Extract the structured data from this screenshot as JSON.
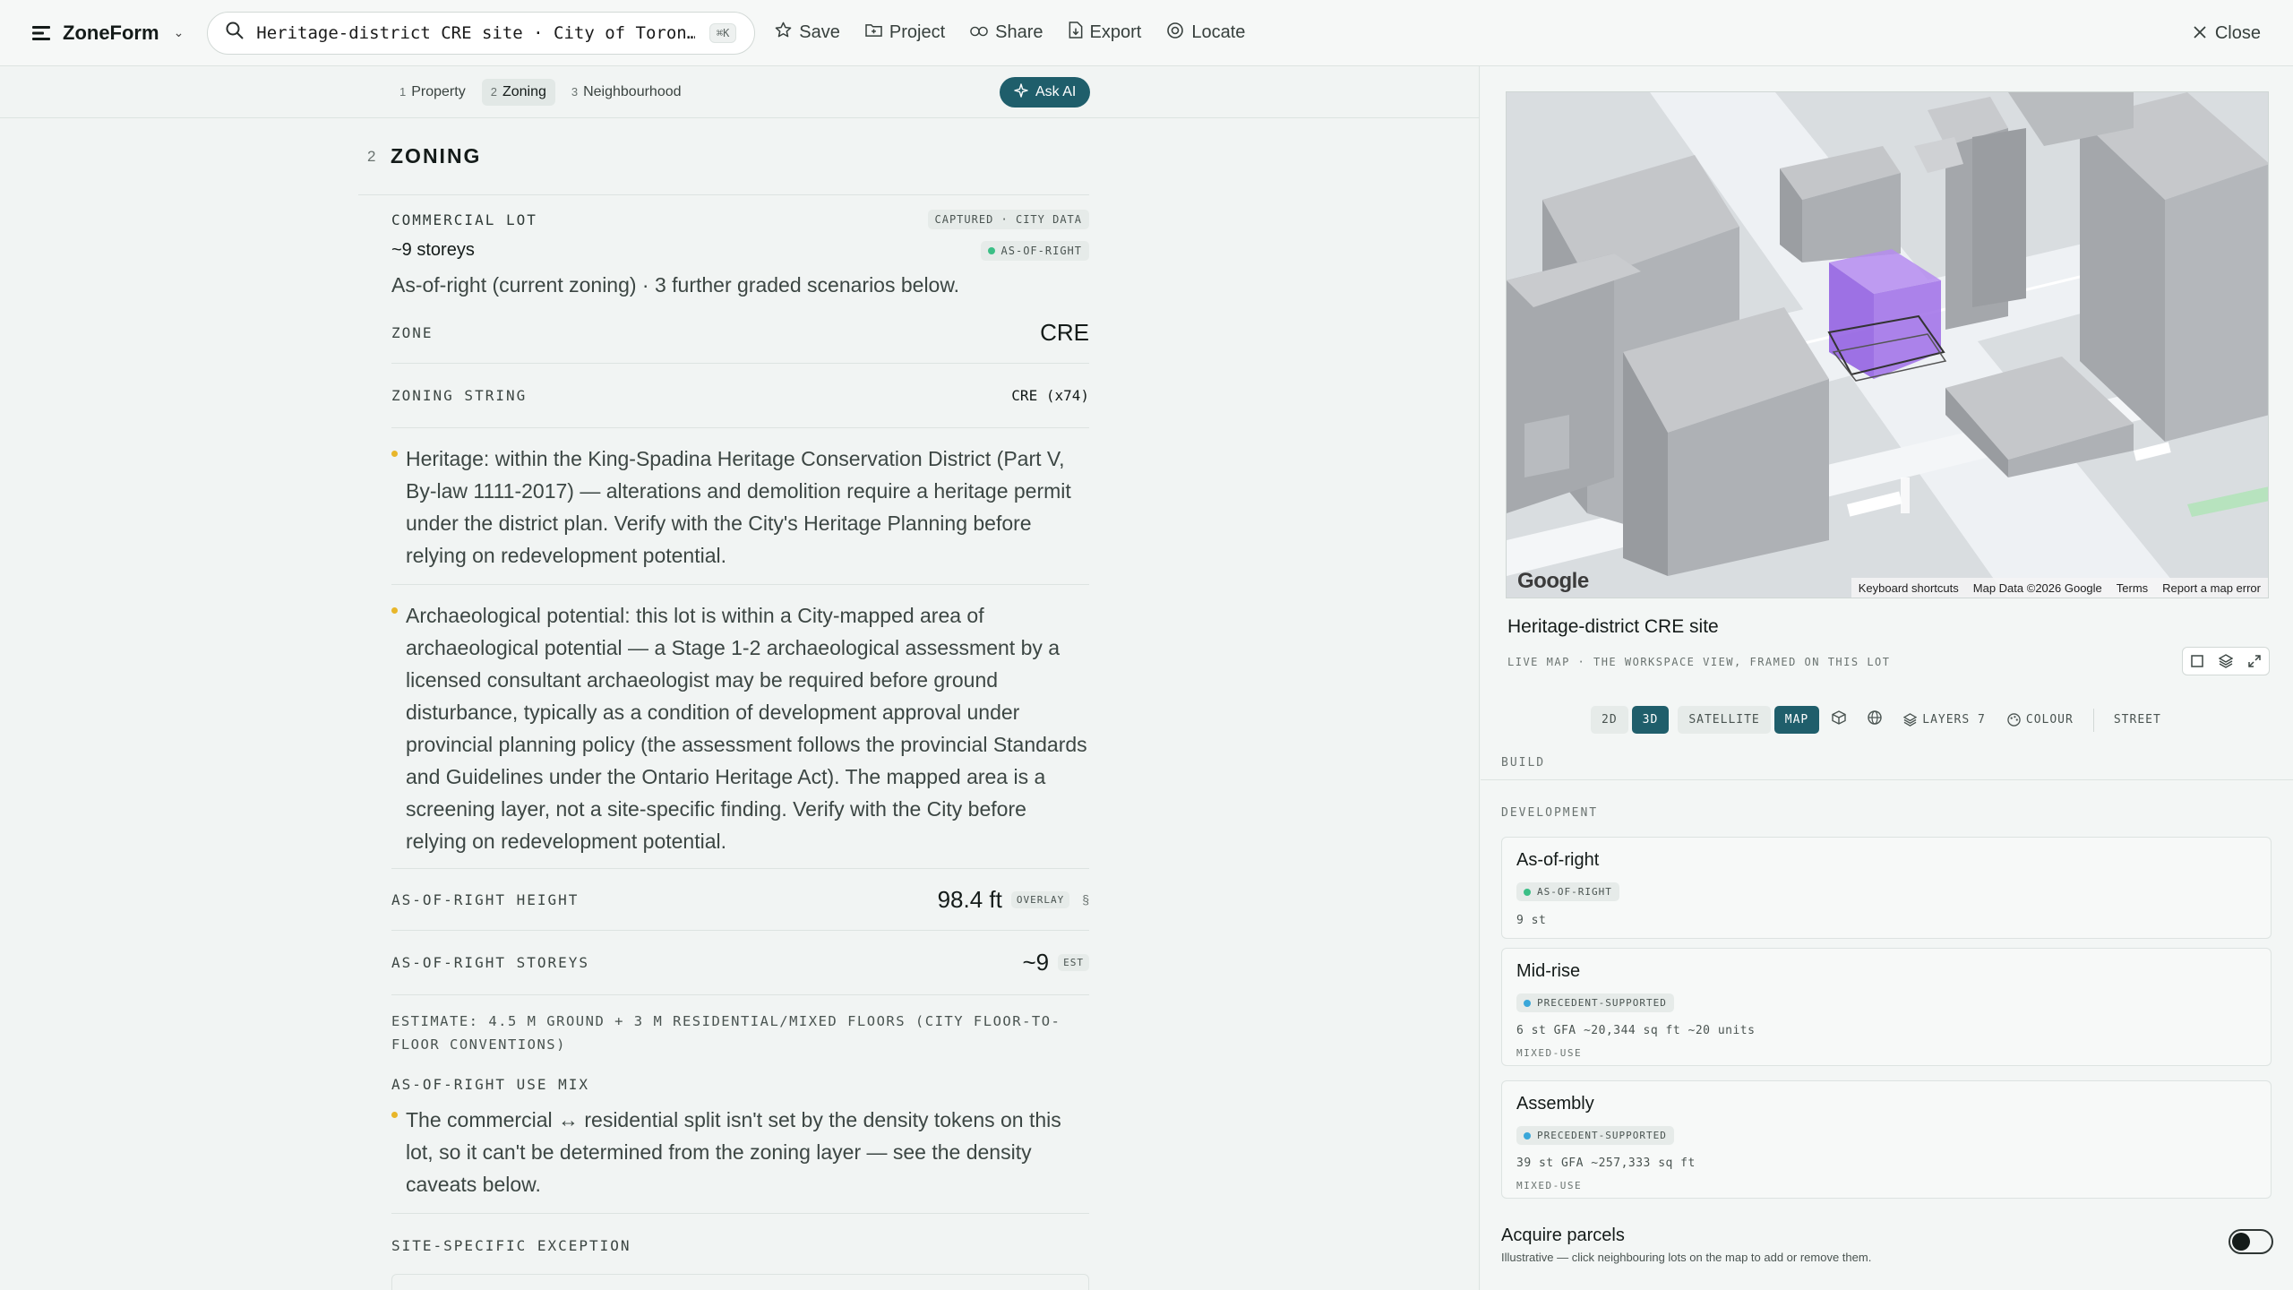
{
  "app": {
    "name": "ZoneForm"
  },
  "search": {
    "query": "Heritage-district CRE site · City of Toron…",
    "shortcut": "⌘K"
  },
  "toolbar": {
    "save": "Save",
    "project": "Project",
    "share": "Share",
    "export": "Export",
    "locate": "Locate",
    "close": "Close"
  },
  "steps": [
    {
      "num": "1",
      "label": "Property"
    },
    {
      "num": "2",
      "label": "Zoning"
    },
    {
      "num": "3",
      "label": "Neighbourhood"
    }
  ],
  "ask_ai": "Ask AI",
  "section": {
    "num": "2",
    "title": "ZONING",
    "lot_label": "COMMERCIAL LOT",
    "lot_tag": "CAPTURED · CITY DATA",
    "storeys": "~9 storeys",
    "storeys_tag": "AS-OF-RIGHT",
    "summary": "As-of-right (current zoning) · 3 further graded scenarios below.",
    "zone_key": "ZONE",
    "zone_val": "CRE",
    "zstring_key": "ZONING STRING",
    "zstring_val": "CRE (x74)",
    "note_heritage": "Heritage: within the King-Spadina Heritage Conservation District (Part V, By-law 1111-2017) — alterations and demolition require a heritage permit under the district plan. Verify with the City's Heritage Planning before relying on redevelopment potential.",
    "note_arch": "Archaeological potential: this lot is within a City-mapped area of archaeological potential — a Stage 1-2 archaeological assessment by a licensed consultant archaeologist may be required before ground disturbance, typically as a condition of development approval under provincial planning policy (the assessment follows the provincial Standards and Guidelines under the Ontario Heritage Act). The mapped area is a screening layer, not a site-specific finding. Verify with the City before relying on redevelopment potential.",
    "height_key": "AS-OF-RIGHT HEIGHT",
    "height_val": "98.4 ft",
    "height_tag": "OVERLAY",
    "height_sect": "§",
    "storeys_key": "AS-OF-RIGHT STOREYS",
    "storeys_val": "~9",
    "storeys_val_tag": "EST",
    "estimate": "ESTIMATE: 4.5 M GROUND + 3 M RESIDENTIAL/MIXED FLOORS (CITY FLOOR-TO-FLOOR CONVENTIONS)",
    "usemix_key": "AS-OF-RIGHT USE MIX",
    "usemix_note": "The commercial ↔ residential split isn't set by the density tokens on this lot, so it can't be determined from the zoning layer — see the density caveats below.",
    "exception_key": "SITE-SPECIFIC EXCEPTION"
  },
  "map": {
    "google": "Google",
    "attribution": [
      "Keyboard shortcuts",
      "Map Data ©2026 Google",
      "Terms",
      "Report a map error"
    ],
    "site_title": "Heritage-district CRE site",
    "site_sub": "LIVE MAP · THE WORKSPACE VIEW, FRAMED ON THIS LOT",
    "views": {
      "v2d": "2D",
      "v3d": "3D",
      "satellite": "SATELLITE",
      "map": "MAP",
      "layers": "LAYERS 7",
      "colour": "COLOUR",
      "street": "STREET"
    }
  },
  "build_label": "BUILD",
  "development_label": "DEVELOPMENT",
  "scenarios": [
    {
      "title": "As-of-right",
      "tag": "AS-OF-RIGHT",
      "meta": "9 st",
      "meta2": ""
    },
    {
      "title": "Mid-rise",
      "tag": "PRECEDENT-SUPPORTED",
      "meta": "6 st  GFA ~20,344 sq ft  ~20 units",
      "meta2": "MIXED-USE"
    },
    {
      "title": "Assembly",
      "tag": "PRECEDENT-SUPPORTED",
      "meta": "39 st  GFA ~257,333 sq ft",
      "meta2": "MIXED-USE"
    }
  ],
  "acquire": {
    "title": "Acquire parcels",
    "sub": "Illustrative — click neighbouring lots on the map to add or remove them."
  },
  "colors": {
    "accent": "#1f5e6b",
    "massing": "#8e5ae0",
    "note_bullet": "#e8b62a"
  }
}
